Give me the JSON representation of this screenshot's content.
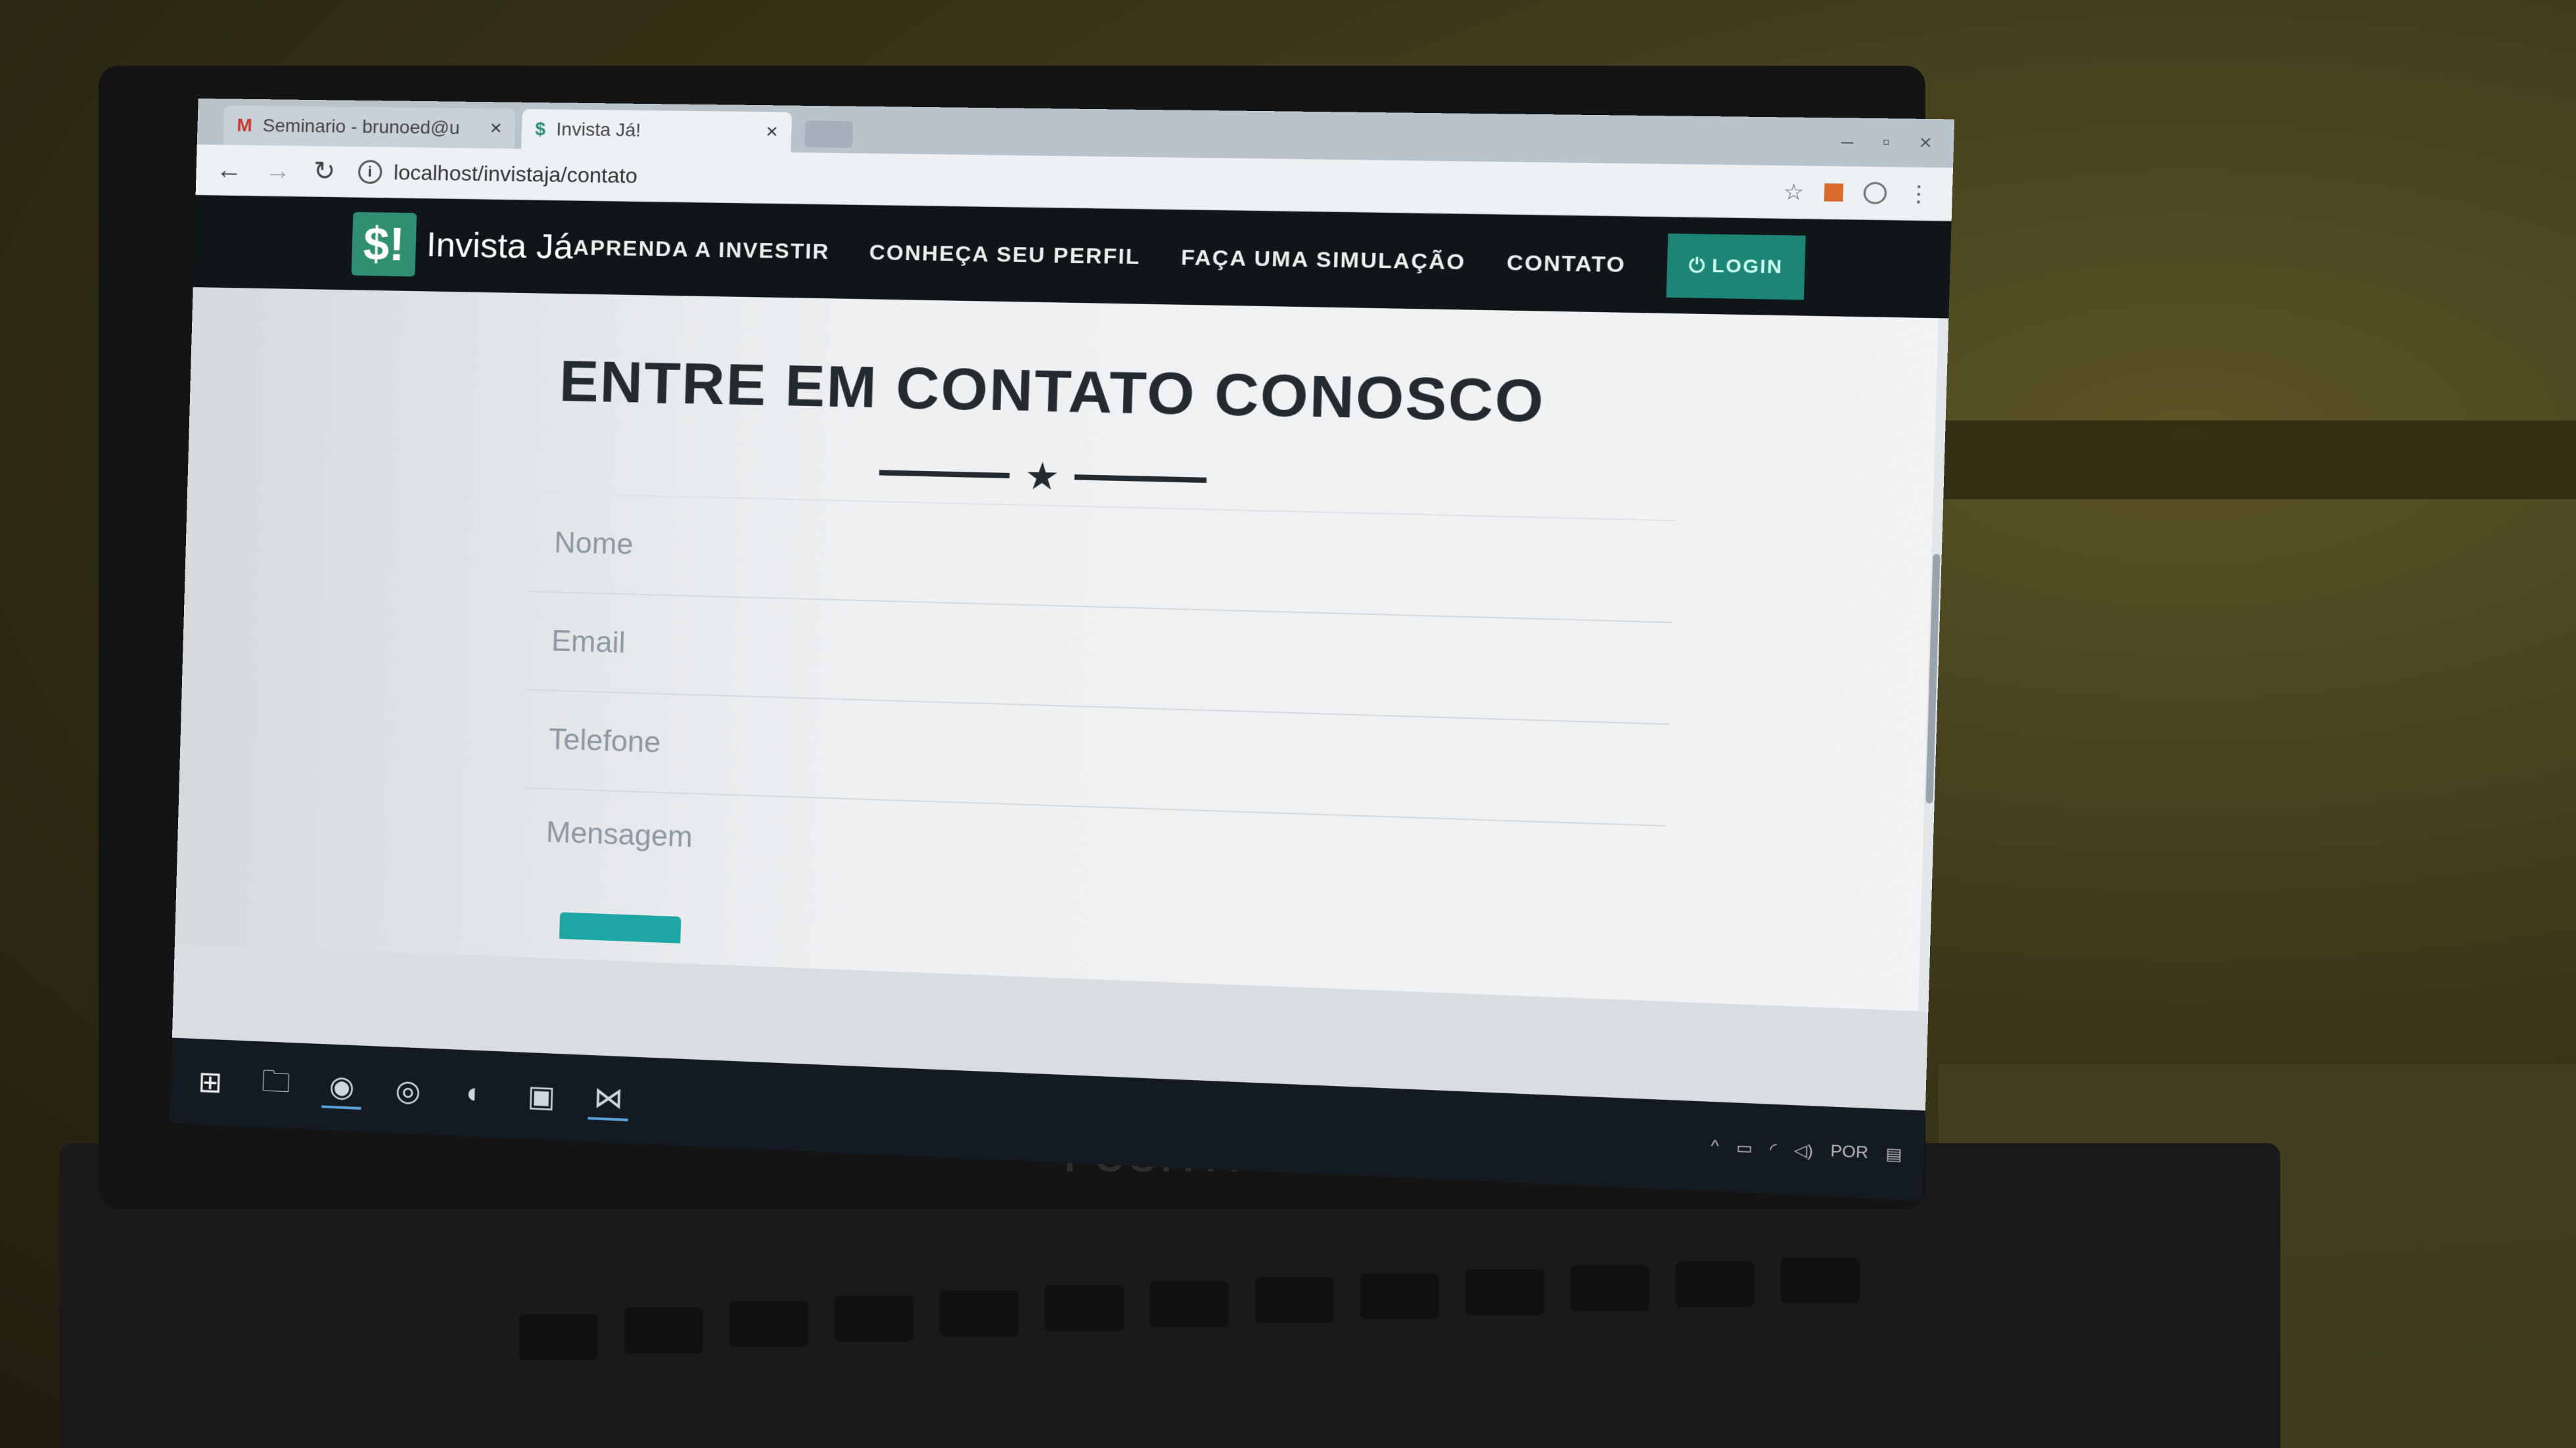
{
  "browser": {
    "tabs": [
      {
        "favicon": "gmail-icon",
        "label": "Seminario - brunoed@u"
      },
      {
        "favicon": "site-favicon",
        "label": "Invista Já!"
      }
    ],
    "url": "localhost/invistaja/contato"
  },
  "site": {
    "logo_mark": "$!",
    "logo_text": "Invista Já",
    "menu": [
      "APRENDA A INVESTIR",
      "CONHEÇA SEU PERFIL",
      "FAÇA UMA SIMULAÇÃO",
      "CONTATO"
    ],
    "login_label": "LOGIN"
  },
  "page": {
    "title": "ENTRE EM CONTATO CONOSCO",
    "form": {
      "name_placeholder": "Nome",
      "email_placeholder": "Email",
      "phone_placeholder": "Telefone",
      "message_placeholder": "Mensagem"
    }
  },
  "tray": {
    "language": "POR"
  },
  "hardware": {
    "brand": "POSITIVO"
  },
  "colors": {
    "accent": "#1d8577",
    "nav_bg": "#101518",
    "title": "#232a30"
  }
}
